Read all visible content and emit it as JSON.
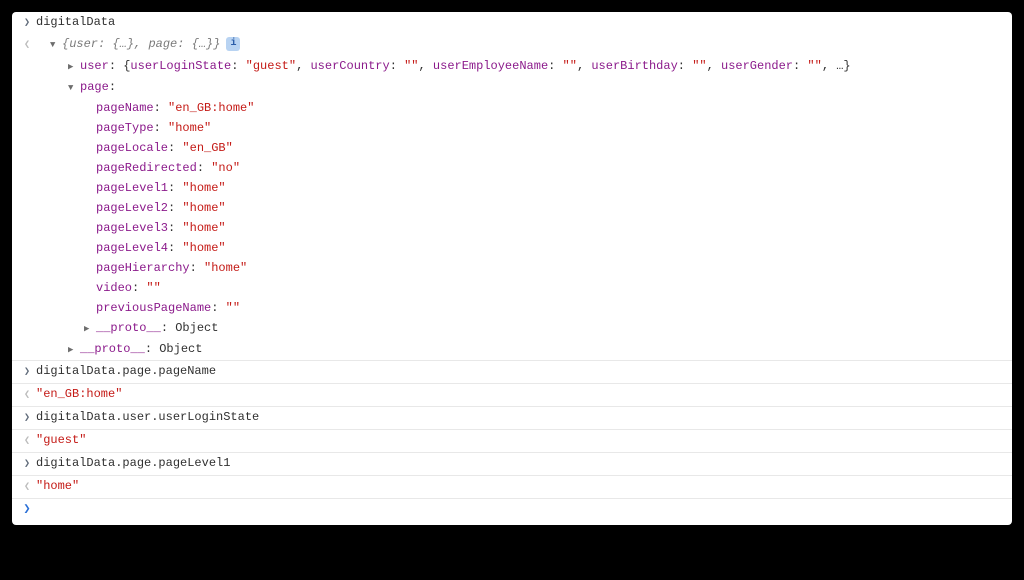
{
  "input1": "digitalData",
  "result1": {
    "summary_prefix": "{",
    "summary_user_key": "user",
    "summary_user_val": "{…}",
    "summary_page_key": "page",
    "summary_page_val": "{…}",
    "summary_suffix": "}",
    "user_key": "user",
    "user_inline": {
      "k1": "userLoginState",
      "v1": "\"guest\"",
      "k2": "userCountry",
      "v2": "\"\"",
      "k3": "userEmployeeName",
      "v3": "\"\"",
      "k4": "userBirthday",
      "v4": "\"\"",
      "k5": "userGender",
      "v5": "\"\"",
      "end": ", …}"
    },
    "page_key": "page",
    "page_props": {
      "pageName": "\"en_GB:home\"",
      "pageType": "\"home\"",
      "pageLocale": "\"en_GB\"",
      "pageRedirected": "\"no\"",
      "pageLevel1": "\"home\"",
      "pageLevel2": "\"home\"",
      "pageLevel3": "\"home\"",
      "pageLevel4": "\"home\"",
      "pageHierarchy": "\"home\"",
      "video": "\"\"",
      "previousPageName": "\"\""
    },
    "proto_label": "__proto__",
    "proto_value": "Object"
  },
  "input2": "digitalData.page.pageName",
  "output2": "\"en_GB:home\"",
  "input3": "digitalData.user.userLoginState",
  "output3": "\"guest\"",
  "input4": "digitalData.page.pageLevel1",
  "output4": "\"home\"",
  "info_badge": "i"
}
